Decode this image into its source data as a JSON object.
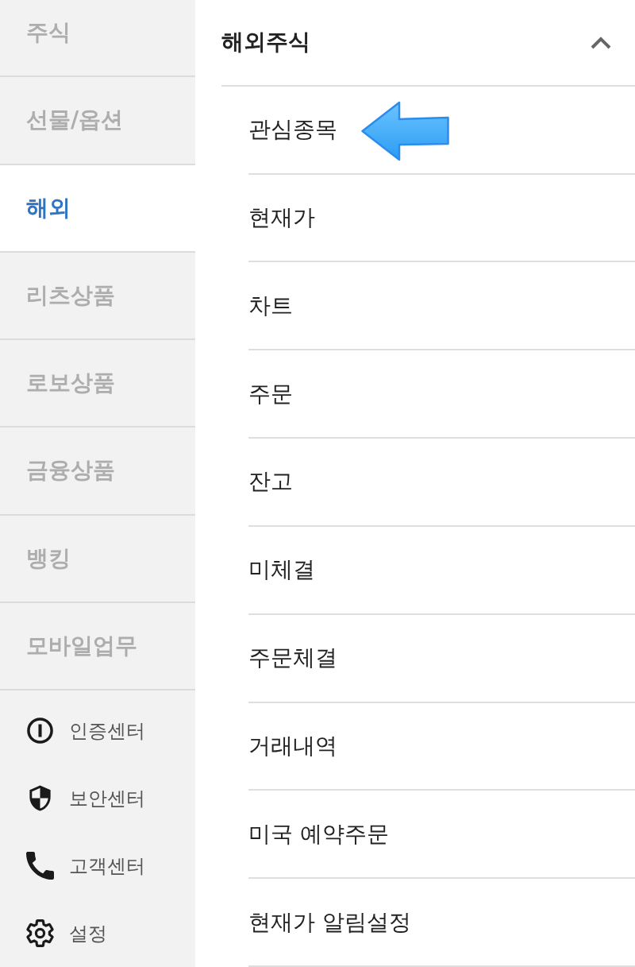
{
  "sidebar": {
    "categories": [
      {
        "label": "주식",
        "selected": false
      },
      {
        "label": "선물/옵션",
        "selected": false
      },
      {
        "label": "해외",
        "selected": true
      },
      {
        "label": "리츠상품",
        "selected": false
      },
      {
        "label": "로보상품",
        "selected": false
      },
      {
        "label": "금융상품",
        "selected": false
      },
      {
        "label": "뱅킹",
        "selected": false
      },
      {
        "label": "모바일업무",
        "selected": false
      }
    ],
    "links": [
      {
        "label": "인증센터",
        "kind": "certificate"
      },
      {
        "label": "보안센터",
        "kind": "security"
      },
      {
        "label": "고객센터",
        "kind": "support"
      },
      {
        "label": "설정",
        "kind": "settings"
      }
    ]
  },
  "submenu": {
    "title": "해외주식",
    "expanded": true,
    "items": [
      {
        "label": "관심종목",
        "marked": true
      },
      {
        "label": "현재가",
        "marked": false
      },
      {
        "label": "차트",
        "marked": false
      },
      {
        "label": "주문",
        "marked": false
      },
      {
        "label": "잔고",
        "marked": false
      },
      {
        "label": "미체결",
        "marked": false
      },
      {
        "label": "주문체결",
        "marked": false
      },
      {
        "label": "거래내역",
        "marked": false
      },
      {
        "label": "미국 예약주문",
        "marked": false
      },
      {
        "label": "현재가 알림설정",
        "marked": false
      }
    ]
  }
}
